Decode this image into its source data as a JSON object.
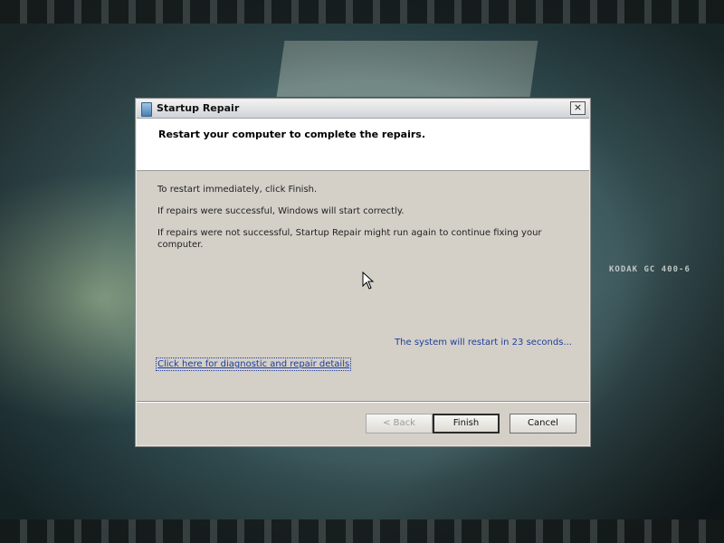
{
  "window": {
    "title": "Startup Repair",
    "close_label": "×"
  },
  "header": {
    "title": "Restart your computer to complete the repairs."
  },
  "content": {
    "line1": "To restart immediately, click Finish.",
    "line2": "If repairs were successful, Windows will start correctly.",
    "line3": "If repairs were not successful, Startup Repair might run again to continue fixing your computer.",
    "countdown": "The system will restart in 23 seconds...",
    "details_link": "Click here for diagnostic and repair details"
  },
  "buttons": {
    "back": "< Back",
    "finish": "Finish",
    "cancel": "Cancel"
  },
  "background": {
    "film_text": "KODAK  GC  400-6"
  },
  "colors": {
    "link": "#1b3aa0",
    "dialog_bg": "#d4d0c8"
  },
  "icons": {
    "title_icon": "startup-repair-icon",
    "close_icon": "close-icon",
    "cursor": "mouse-pointer-icon"
  }
}
